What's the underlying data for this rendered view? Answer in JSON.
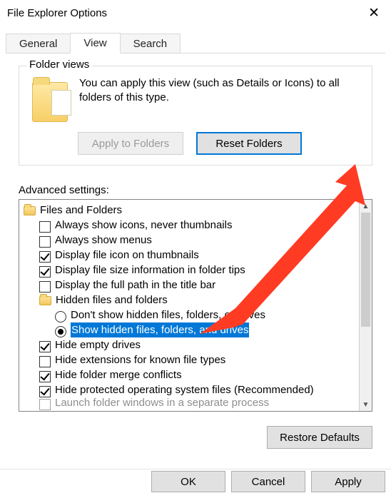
{
  "window": {
    "title": "File Explorer Options"
  },
  "tabs": {
    "general": "General",
    "view": "View",
    "search": "Search",
    "active": "view"
  },
  "folder_views": {
    "legend": "Folder views",
    "description": "You can apply this view (such as Details or Icons) to all folders of this type.",
    "apply_btn": "Apply to Folders",
    "reset_btn": "Reset Folders"
  },
  "advanced": {
    "label": "Advanced settings:",
    "tree": {
      "root": "Files and Folders",
      "items": [
        {
          "kind": "checkbox",
          "checked": false,
          "label": "Always show icons, never thumbnails"
        },
        {
          "kind": "checkbox",
          "checked": false,
          "label": "Always show menus"
        },
        {
          "kind": "checkbox",
          "checked": true,
          "label": "Display file icon on thumbnails"
        },
        {
          "kind": "checkbox",
          "checked": true,
          "label": "Display file size information in folder tips"
        },
        {
          "kind": "checkbox",
          "checked": false,
          "label": "Display the full path in the title bar"
        },
        {
          "kind": "folder",
          "label": "Hidden files and folders"
        },
        {
          "kind": "radio",
          "checked": false,
          "label": "Don't show hidden files, folders, or drives"
        },
        {
          "kind": "radio",
          "checked": true,
          "label": "Show hidden files, folders, and drives",
          "highlighted": true
        },
        {
          "kind": "checkbox",
          "checked": true,
          "label": "Hide empty drives"
        },
        {
          "kind": "checkbox",
          "checked": false,
          "label": "Hide extensions for known file types"
        },
        {
          "kind": "checkbox",
          "checked": true,
          "label": "Hide folder merge conflicts"
        },
        {
          "kind": "checkbox",
          "checked": true,
          "label": "Hide protected operating system files (Recommended)"
        },
        {
          "kind": "checkbox",
          "checked": false,
          "label": "Launch folder windows in a separate process",
          "cutoff": true
        }
      ]
    },
    "restore_btn": "Restore Defaults"
  },
  "footer": {
    "ok": "OK",
    "cancel": "Cancel",
    "apply": "Apply"
  },
  "annotation": {
    "arrow_color": "#ff3b24"
  }
}
